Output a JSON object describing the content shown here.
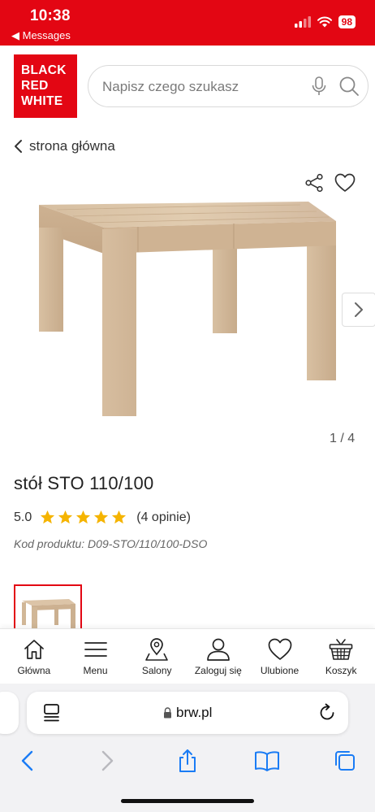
{
  "status_bar": {
    "time": "10:38",
    "back_label": "◀ Messages",
    "battery": "98"
  },
  "header": {
    "logo_lines": [
      "BLACK",
      "RED",
      "WHITE"
    ],
    "search_placeholder": "Napisz czego szukasz"
  },
  "breadcrumb": {
    "label": "strona główna"
  },
  "gallery": {
    "pager": "1 / 4"
  },
  "product": {
    "title": "stół STO 110/100",
    "rating_value": "5.0",
    "stars": 5,
    "reviews": "(4 opinie)",
    "code": "Kod produktu: D09-STO/110/100-DSO"
  },
  "bottom_nav": [
    {
      "label": "Główna",
      "icon": "home-icon"
    },
    {
      "label": "Menu",
      "icon": "menu-icon"
    },
    {
      "label": "Salony",
      "icon": "map-pin-icon"
    },
    {
      "label": "Zaloguj się",
      "icon": "user-icon"
    },
    {
      "label": "Ulubione",
      "icon": "heart-icon"
    },
    {
      "label": "Koszyk",
      "icon": "basket-icon"
    }
  ],
  "browser": {
    "url": "brw.pl"
  },
  "colors": {
    "brand": "#e30613",
    "star": "#f5b400",
    "wood": "#d9c2a5"
  }
}
